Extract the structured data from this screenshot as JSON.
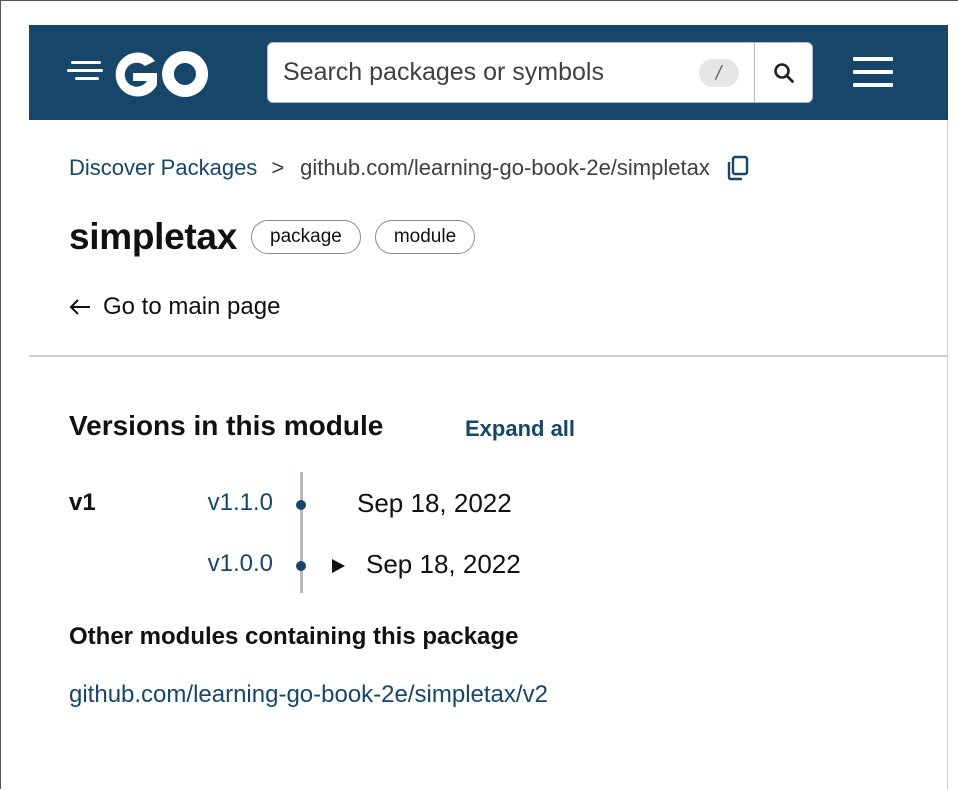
{
  "header": {
    "logo_text": "GO",
    "search": {
      "placeholder": "Search packages or symbols",
      "value": "",
      "shortcut": "/"
    },
    "icons": {
      "search": "search-icon",
      "menu": "hamburger-menu-icon",
      "logo": "go-logo-icon"
    }
  },
  "breadcrumb": {
    "root": "Discover Packages",
    "separator": ">",
    "current": "github.com/learning-go-book-2e/simpletax",
    "copy_icon": "copy-icon"
  },
  "package": {
    "name": "simpletax",
    "badges": [
      "package",
      "module"
    ],
    "back_link": "Go to main page",
    "back_icon": "arrow-left-icon"
  },
  "versions": {
    "heading": "Versions in this module",
    "expand_all": "Expand all",
    "major": "v1",
    "items": [
      {
        "version": "v1.1.0",
        "date": "Sep 18, 2022",
        "expandable": false
      },
      {
        "version": "v1.0.0",
        "date": "Sep 18, 2022",
        "expandable": true
      }
    ]
  },
  "other_modules": {
    "heading": "Other modules containing this package",
    "links": [
      "github.com/learning-go-book-2e/simpletax/v2"
    ]
  },
  "colors": {
    "header_bg": "#16476a",
    "link": "#16476a",
    "text": "#111111",
    "divider": "#c9ccd0"
  }
}
